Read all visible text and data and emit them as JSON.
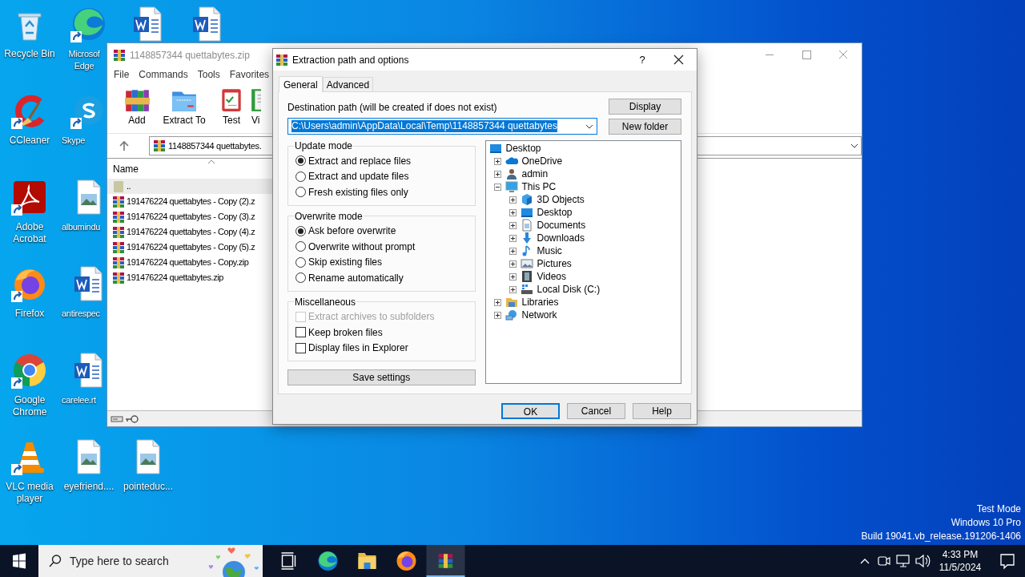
{
  "desktop": {
    "icons": [
      {
        "label": "Recycle Bin",
        "kind": "recycle",
        "shortcut": false
      },
      {
        "label": "CCleaner",
        "kind": "ccleaner",
        "shortcut": true
      },
      {
        "label": "Adobe Acrobat",
        "kind": "acrobat",
        "shortcut": true
      },
      {
        "label": "Firefox",
        "kind": "firefox",
        "shortcut": true
      },
      {
        "label": "Google Chrome",
        "kind": "chrome",
        "shortcut": true
      },
      {
        "label": "VLC media player",
        "kind": "vlc",
        "shortcut": true
      },
      {
        "label": "Microsof Edge",
        "kind": "edge",
        "shortcut": true
      },
      {
        "label": "Skype",
        "kind": "skype",
        "shortcut": true
      },
      {
        "label": "albumindu",
        "kind": "image",
        "shortcut": false
      },
      {
        "label": "antirespec",
        "kind": "word",
        "shortcut": false
      },
      {
        "label": "carelee.rt",
        "kind": "word",
        "shortcut": false
      },
      {
        "label": "eyefriend....",
        "kind": "image",
        "shortcut": false
      },
      {
        "kind": "word",
        "shortcut": false
      },
      {
        "label": "pointeduc...",
        "kind": "image",
        "shortcut": false
      },
      {
        "kind": "word",
        "shortcut": false
      }
    ],
    "system_info": [
      "Test Mode",
      "Windows 10 Pro",
      "Build 19041.vb_release.191206-1406"
    ]
  },
  "archive_window": {
    "title": "1148857344 quettabytes.zip",
    "menu": [
      "File",
      "Commands",
      "Tools",
      "Favorites"
    ],
    "toolbar": [
      {
        "label": "Add",
        "kind": "add"
      },
      {
        "label": "Extract To",
        "kind": "extract"
      },
      {
        "label": "Test",
        "kind": "test"
      },
      {
        "label": "Vi",
        "kind": "view"
      }
    ],
    "address": "1148857344 quettabytes.",
    "column": "Name",
    "files": [
      {
        "name": "..",
        "kind": "up",
        "selected": true
      },
      {
        "name": "191476224 quettabytes - Copy (2).z",
        "kind": "archive",
        "selected": false
      },
      {
        "name": "191476224 quettabytes - Copy (3).z",
        "kind": "archive",
        "selected": false
      },
      {
        "name": "191476224 quettabytes - Copy (4).z",
        "kind": "archive",
        "selected": false
      },
      {
        "name": "191476224 quettabytes - Copy (5).z",
        "kind": "archive",
        "selected": false
      },
      {
        "name": "191476224 quettabytes - Copy.zip",
        "kind": "archive",
        "selected": false
      },
      {
        "name": "191476224 quettabytes.zip",
        "kind": "archive",
        "selected": false
      }
    ]
  },
  "dialog": {
    "title": "Extraction path and options",
    "help": "?",
    "tabs": [
      {
        "label": "General",
        "selected": true
      },
      {
        "label": "Advanced",
        "selected": false
      }
    ],
    "destination": {
      "label": "Destination path (will be created if does not exist)",
      "value": "C:\\Users\\admin\\AppData\\Local\\Temp\\1148857344 quettabytes",
      "text_selected": true
    },
    "side_buttons": [
      "Display",
      "New folder"
    ],
    "groups": [
      {
        "title": "Update mode",
        "options": [
          {
            "label": "Extract and replace files",
            "kind": "radio",
            "checked": true,
            "disabled": false
          },
          {
            "label": "Extract and update files",
            "kind": "radio",
            "checked": false,
            "disabled": false
          },
          {
            "label": "Fresh existing files only",
            "kind": "radio",
            "checked": false,
            "disabled": false
          }
        ]
      },
      {
        "title": "Overwrite mode",
        "options": [
          {
            "label": "Ask before overwrite",
            "kind": "radio",
            "checked": true,
            "disabled": false
          },
          {
            "label": "Overwrite without prompt",
            "kind": "radio",
            "checked": false,
            "disabled": false
          },
          {
            "label": "Skip existing files",
            "kind": "radio",
            "checked": false,
            "disabled": false
          },
          {
            "label": "Rename automatically",
            "kind": "radio",
            "checked": false,
            "disabled": false
          }
        ]
      },
      {
        "title": "Miscellaneous",
        "options": [
          {
            "label": "Extract archives to subfolders",
            "kind": "checkbox",
            "checked": false,
            "disabled": true
          },
          {
            "label": "Keep broken files",
            "kind": "checkbox",
            "checked": false,
            "disabled": false
          },
          {
            "label": "Display files in Explorer",
            "kind": "checkbox",
            "checked": false,
            "disabled": false
          }
        ]
      }
    ],
    "save_button": "Save settings",
    "tree": [
      {
        "label": "Desktop",
        "kind": "desktop",
        "children": [
          {
            "label": "OneDrive",
            "kind": "cloud",
            "expanded": false
          },
          {
            "label": "admin",
            "kind": "user",
            "expanded": false
          },
          {
            "label": "This PC",
            "kind": "pc",
            "expanded": true,
            "children": [
              {
                "label": "3D Objects",
                "kind": "cube",
                "expanded": false
              },
              {
                "label": "Desktop",
                "kind": "desktop",
                "expanded": false
              },
              {
                "label": "Documents",
                "kind": "documents",
                "expanded": false
              },
              {
                "label": "Downloads",
                "kind": "downloads",
                "expanded": false
              },
              {
                "label": "Music",
                "kind": "music",
                "expanded": false
              },
              {
                "label": "Pictures",
                "kind": "pictures",
                "expanded": false
              },
              {
                "label": "Videos",
                "kind": "videos",
                "expanded": false
              },
              {
                "label": "Local Disk (C:)",
                "kind": "disk",
                "expanded": false
              }
            ]
          },
          {
            "label": "Libraries",
            "kind": "libraries",
            "expanded": false
          },
          {
            "label": "Network",
            "kind": "network",
            "expanded": false
          }
        ]
      }
    ],
    "buttons": [
      {
        "label": "OK",
        "default": true
      },
      {
        "label": "Cancel",
        "default": false
      },
      {
        "label": "Help",
        "default": false
      }
    ]
  },
  "taskbar": {
    "search_placeholder": "Type here to search",
    "apps": [
      {
        "kind": "taskview",
        "active": false
      },
      {
        "kind": "edge",
        "active": false
      },
      {
        "kind": "explorer",
        "active": false
      },
      {
        "kind": "firefox",
        "active": false
      },
      {
        "kind": "archiver",
        "active": true
      }
    ],
    "time": "4:33 PM",
    "date": "11/5/2024"
  }
}
